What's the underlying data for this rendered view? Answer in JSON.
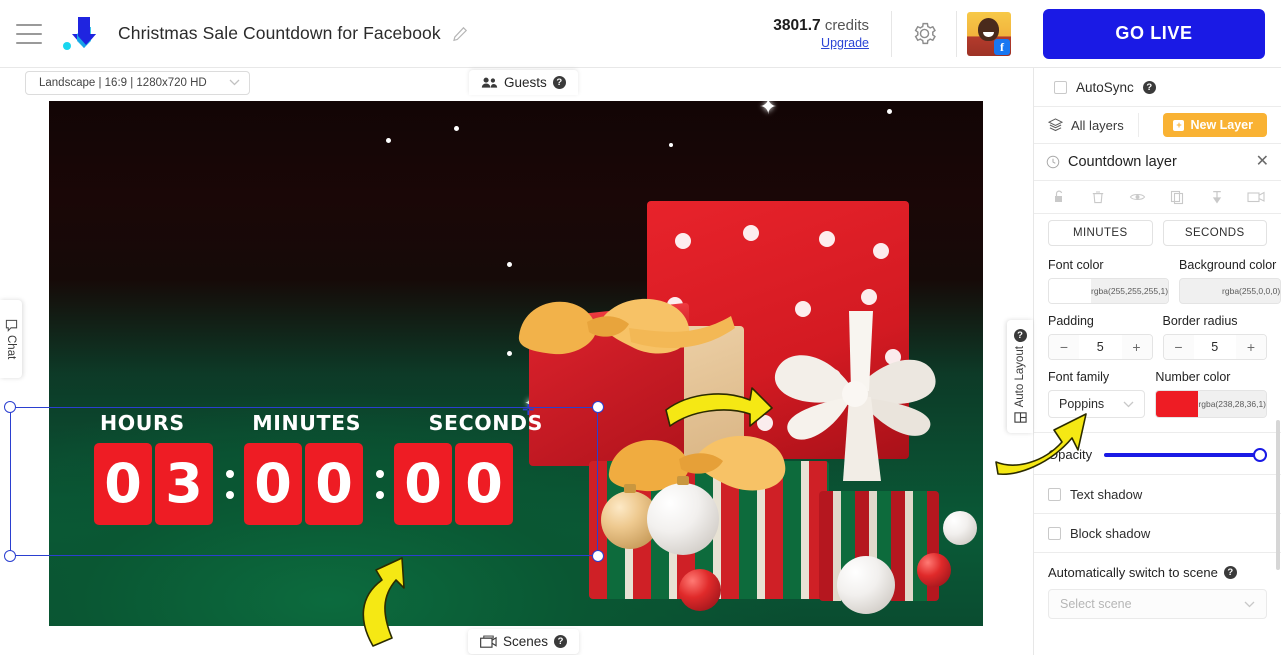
{
  "header": {
    "menu_icon": "hamburger-icon",
    "logo_icon": "brand-logo-icon",
    "title": "Christmas Sale Countdown for Facebook",
    "edit_icon": "pencil-icon",
    "credits_amount": "3801.7",
    "credits_label": "credits",
    "upgrade_label": "Upgrade",
    "settings_icon": "gear-icon",
    "avatar_icon": "user-avatar",
    "avatar_badge": "facebook-icon",
    "golive_label": "GO LIVE",
    "golive_color": "#1a1ae5"
  },
  "toolbar": {
    "ratio_value": "Landscape | 16:9 | 1280x720 HD",
    "guests_label": "Guests",
    "scenes_label": "Scenes"
  },
  "left_rail": {
    "chat_label": "Chat"
  },
  "canvas": {
    "auto_layout_label": "Auto Layout",
    "countdown": {
      "labels": [
        "HOURS",
        "MINUTES",
        "SECONDS"
      ],
      "hours": [
        "0",
        "3"
      ],
      "minutes": [
        "0",
        "0"
      ],
      "seconds": [
        "0",
        "0"
      ],
      "digit_bg": "#ee1c24",
      "digit_color": "#ffffff"
    }
  },
  "panel": {
    "autosync_label": "AutoSync",
    "all_layers_label": "All layers",
    "new_layer_label": "New Layer",
    "new_layer_color": "#f9b233",
    "layer_name": "Countdown layer",
    "layer_icons": [
      "unlock-icon",
      "trash-icon",
      "eye-icon",
      "duplicate-icon",
      "pin-icon",
      "screen-icon"
    ],
    "close_icon": "close-icon",
    "tabs": [
      "MINUTES",
      "SECONDS"
    ],
    "font_color": {
      "label": "Font color",
      "value": "rgba(255,255,255,1)",
      "swatch": "#ffffff"
    },
    "background_color": {
      "label": "Background color",
      "value": "rgba(255,0,0,0)",
      "swatch": "transparent"
    },
    "padding": {
      "label": "Padding",
      "value": "5",
      "minus": "−",
      "plus": "+"
    },
    "border_radius": {
      "label": "Border radius",
      "value": "5",
      "minus": "−",
      "plus": "+"
    },
    "font_family": {
      "label": "Font family",
      "value": "Poppins"
    },
    "number_color": {
      "label": "Number color",
      "value": "rgba(238,28,36,1)",
      "swatch": "#ee1c24"
    },
    "opacity": {
      "label": "Opacity",
      "value": 100,
      "color": "#1a1ae5"
    },
    "text_shadow_label": "Text shadow",
    "block_shadow_label": "Block shadow",
    "auto_switch_label": "Automatically switch to scene",
    "scene_placeholder": "Select scene"
  }
}
